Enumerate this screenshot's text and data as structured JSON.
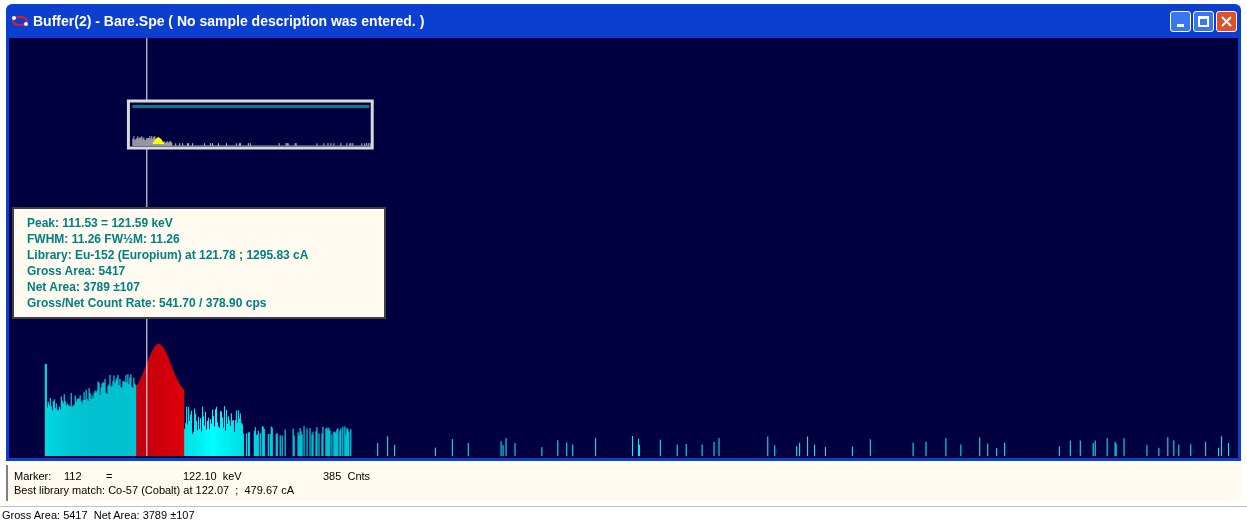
{
  "window": {
    "title": "Buffer(2) - Bare.Spe ( No sample description was entered. )"
  },
  "peak_info": {
    "lines": [
      "Peak: 111.53 = 121.59 keV",
      "FWHM: 11.26  FW½M: 11.26",
      "Library: Eu-152 (Europium) at 121.78 ;  1295.83 cA",
      "Gross Area: 5417",
      "Net Area: 3789 ±107",
      "Gross/Net Count Rate: 541.70 / 378.90 cps"
    ]
  },
  "marker_panel": {
    "label": "Marker:",
    "channel": "112",
    "equals": "=",
    "energy": "122.10  keV",
    "counts": "385  Cnts",
    "library_match": "Best library match: Co-57 (Cobalt) at 122.07  ;  479.67 cA"
  },
  "status_bar": "Gross Area: 5417  Net Area: 3789 ±107"
}
